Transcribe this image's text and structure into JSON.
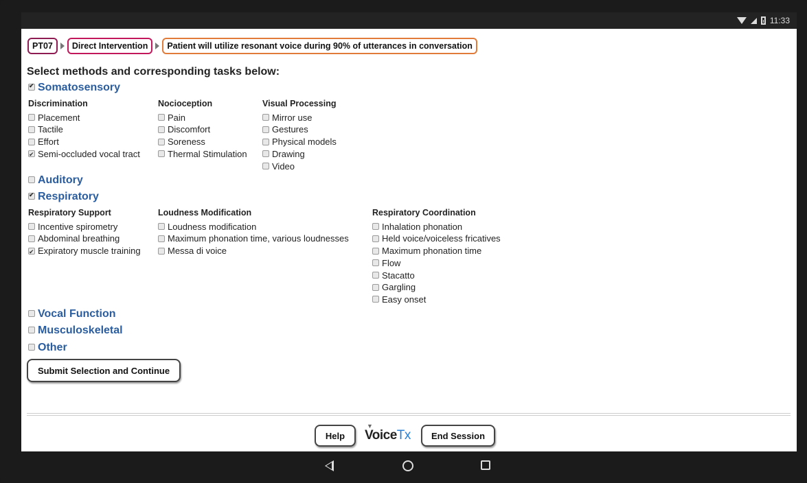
{
  "status_bar": {
    "time": "11:33"
  },
  "breadcrumb": {
    "patient": "PT07",
    "phase": "Direct Intervention",
    "goal": "Patient will utilize resonant voice during 90% of utterances in conversation"
  },
  "heading": "Select methods and corresponding tasks below:",
  "somatosensory": {
    "label": "Somatosensory",
    "checked": true,
    "groups": [
      {
        "title": "Discrimination",
        "items": [
          {
            "label": "Placement",
            "checked": false
          },
          {
            "label": "Tactile",
            "checked": false
          },
          {
            "label": "Effort",
            "checked": false
          },
          {
            "label": "Semi-occluded vocal tract",
            "checked": true
          }
        ]
      },
      {
        "title": "Nocioception",
        "items": [
          {
            "label": "Pain",
            "checked": false
          },
          {
            "label": "Discomfort",
            "checked": false
          },
          {
            "label": "Soreness",
            "checked": false
          },
          {
            "label": "Thermal Stimulation",
            "checked": false
          }
        ]
      },
      {
        "title": "Visual Processing",
        "items": [
          {
            "label": "Mirror use",
            "checked": false
          },
          {
            "label": "Gestures",
            "checked": false
          },
          {
            "label": "Physical models",
            "checked": false
          },
          {
            "label": "Drawing",
            "checked": false
          },
          {
            "label": "Video",
            "checked": false
          }
        ]
      }
    ]
  },
  "auditory": {
    "label": "Auditory",
    "checked": false
  },
  "respiratory": {
    "label": "Respiratory",
    "checked": true,
    "groups": [
      {
        "title": "Respiratory Support",
        "items": [
          {
            "label": "Incentive spirometry",
            "checked": false
          },
          {
            "label": "Abdominal breathing",
            "checked": false
          },
          {
            "label": "Expiratory muscle training",
            "checked": true
          }
        ]
      },
      {
        "title": "Loudness Modification",
        "items": [
          {
            "label": "Loudness modification",
            "checked": false
          },
          {
            "label": "Maximum phonation time, various loudnesses",
            "checked": false
          },
          {
            "label": "Messa di voice",
            "checked": false
          }
        ]
      },
      {
        "title": "Respiratory Coordination",
        "items": [
          {
            "label": "Inhalation phonation",
            "checked": false
          },
          {
            "label": "Held voice/voiceless fricatives",
            "checked": false
          },
          {
            "label": "Maximum phonation time",
            "checked": false
          },
          {
            "label": "Flow",
            "checked": false
          },
          {
            "label": "Stacatto",
            "checked": false
          },
          {
            "label": "Gargling",
            "checked": false
          },
          {
            "label": "Easy onset",
            "checked": false
          }
        ]
      }
    ]
  },
  "vocal_function": {
    "label": "Vocal Function",
    "checked": false
  },
  "musculoskeletal": {
    "label": "Musculoskeletal",
    "checked": false
  },
  "other": {
    "label": "Other",
    "checked": false
  },
  "submit_label": "Submit Selection and Continue",
  "footer": {
    "help_label": "Help",
    "logo_part1": "Voice",
    "logo_part2": "Tx",
    "end_label": "End Session"
  }
}
